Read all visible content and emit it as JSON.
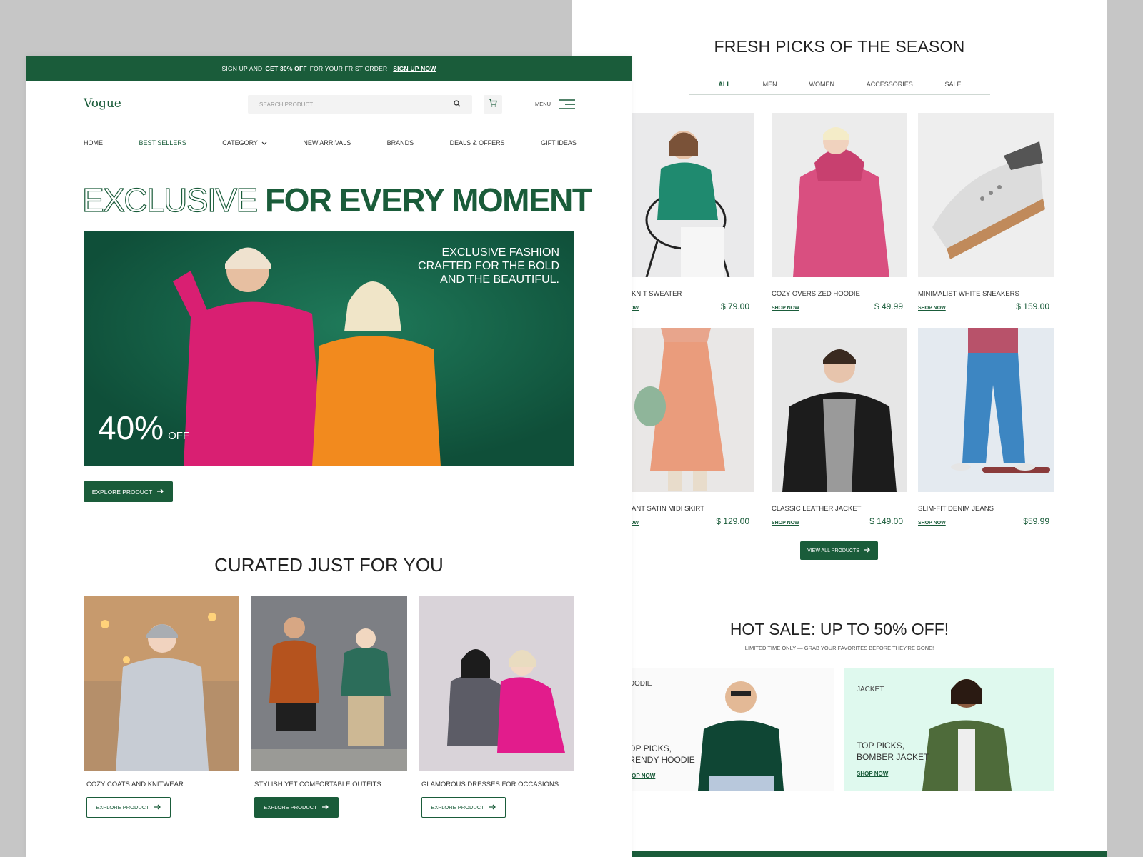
{
  "promo": {
    "pre": "SIGN UP AND",
    "bold": "GET 30% OFF",
    "post": "FOR YOUR FRIST ORDER",
    "link": "SIGN UP NOW"
  },
  "header": {
    "logo": "Vogue",
    "search_placeholder": "SEARCH PRODUCT",
    "search_icon": "search-icon",
    "cart_icon": "cart-icon",
    "menu_label": "MENU",
    "menu_icon": "hamburger-icon"
  },
  "nav": {
    "items": [
      {
        "label": "HOME",
        "active": false
      },
      {
        "label": "BEST SELLERS",
        "active": true
      },
      {
        "label": "CATEGORY",
        "active": false,
        "dropdown": true
      },
      {
        "label": "NEW ARRIVALS",
        "active": false
      },
      {
        "label": "BRANDS",
        "active": false
      },
      {
        "label": "DEALS & OFFERS",
        "active": false
      },
      {
        "label": "GIFT IDEAS",
        "active": false
      }
    ]
  },
  "hero": {
    "title_outline": "EXCLUSIVE",
    "title_solid": "FOR EVERY MOMENT",
    "banner_line1": "EXCLUSIVE FASHION",
    "banner_line2": "CRAFTED FOR THE BOLD",
    "banner_line3": "AND THE BEAUTIFUL.",
    "discount": "40%",
    "discount_suffix": "OFF",
    "cta": "EXPLORE PRODUCT"
  },
  "curated": {
    "title": "CURATED JUST FOR YOU",
    "cards": [
      {
        "caption": "COZY COATS AND KNITWEAR.",
        "button": "EXPLORE PRODUCT"
      },
      {
        "caption": "STYLISH YET COMFORTABLE OUTFITS",
        "button": "EXPLORE PRODUCT"
      },
      {
        "caption": "GLAMOROUS DRESSES FOR OCCASIONS",
        "button": "EXPLORE PRODUCT"
      }
    ]
  },
  "fresh": {
    "title": "FRESH PICKS OF THE SEASON",
    "tabs": [
      {
        "label": "ALL",
        "active": true
      },
      {
        "label": "MEN",
        "active": false
      },
      {
        "label": "WOMEN",
        "active": false
      },
      {
        "label": "ACCESSORIES",
        "active": false
      },
      {
        "label": "SALE",
        "active": false
      }
    ],
    "products": [
      {
        "name": "HIC KNIT SWEATER",
        "price": "$ 79.00",
        "shop": "OP NOW"
      },
      {
        "name": "COZY OVERSIZED HOODIE",
        "price": "$ 49.99",
        "shop": "SHOP NOW"
      },
      {
        "name": "MINIMALIST WHITE SNEAKERS",
        "price": "$ 159.00",
        "shop": "SHOP NOW"
      },
      {
        "name": "LEGANT SATIN MIDI SKIRT",
        "price": "$ 129.00",
        "shop": "OP NOW"
      },
      {
        "name": "CLASSIC LEATHER JACKET",
        "price": "$ 149.00",
        "shop": "SHOP NOW"
      },
      {
        "name": "SLIM-FIT DENIM JEANS",
        "price": "$59.99",
        "shop": "SHOP NOW"
      }
    ],
    "view_all": "VIEW ALL PRODUCTS"
  },
  "hot_sale": {
    "title": "HOT SALE: UP TO 50% OFF!",
    "subtitle": "LIMITED TIME ONLY — GRAB YOUR FAVORITES BEFORE THEY'RE GONE!",
    "cards": [
      {
        "category": "HOODIE",
        "pick": "TOP PICKS, TRENDY HOODIE",
        "shop": "SHOP NOW"
      },
      {
        "category": "JACKET",
        "pick": "TOP PICKS, BOMBER JACKET",
        "shop": "SHOP NOW"
      }
    ]
  },
  "colors": {
    "brand_green": "#1a5c3a",
    "mint": "#dff9ee",
    "banner_green": "#145a41"
  }
}
